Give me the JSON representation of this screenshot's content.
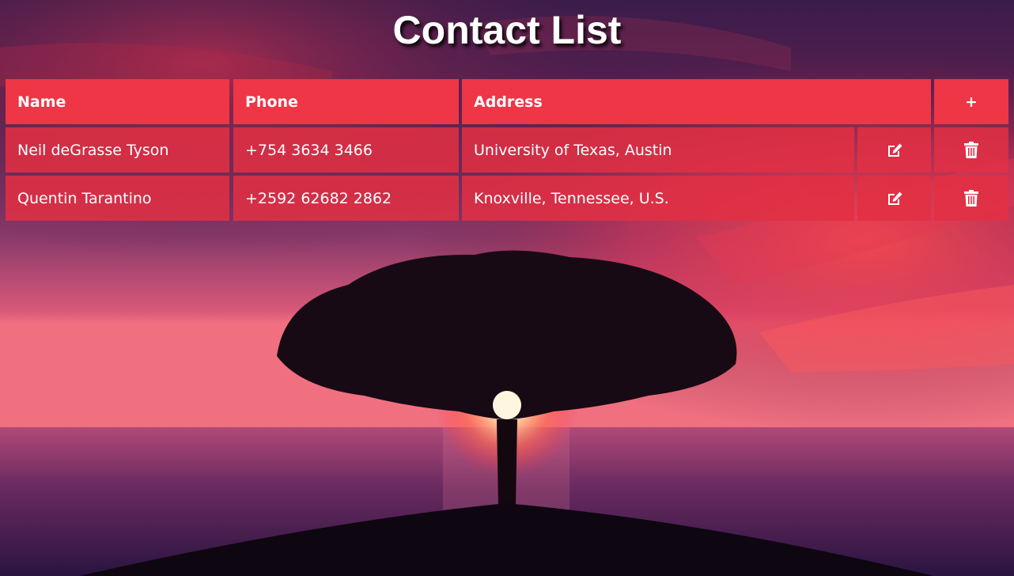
{
  "page": {
    "title": "Contact List"
  },
  "table": {
    "headers": {
      "name": "Name",
      "phone": "Phone",
      "address": "Address",
      "add": "+"
    },
    "rows": [
      {
        "name": "Neil deGrasse Tyson",
        "phone": "+754 3634 3466",
        "address": "University of Texas, Austin",
        "edit_icon": "edit-icon",
        "delete_icon": "trash-icon"
      },
      {
        "name": "Quentin Tarantino",
        "phone": "+2592 62682 2862",
        "address": "Knoxville, Tennessee, U.S.",
        "edit_icon": "edit-icon",
        "delete_icon": "trash-icon"
      }
    ]
  },
  "colors": {
    "header_cell": "#ee3646",
    "body_cell": "#e23044",
    "text": "#ffffff"
  }
}
